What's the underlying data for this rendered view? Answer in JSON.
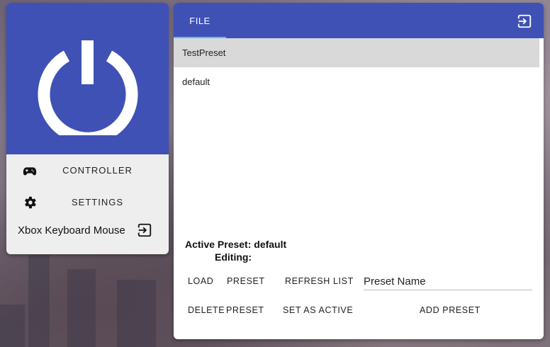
{
  "sidebar": {
    "items": [
      {
        "label": "CONTROLLER",
        "icon": "gamepad-icon"
      },
      {
        "label": "SETTINGS",
        "icon": "gear-icon"
      }
    ],
    "app_name": "Xbox Keyboard Mouse",
    "exit_icon": "exit-icon",
    "hero_icon": "power-icon"
  },
  "header": {
    "tab_file": "FILE",
    "exit_icon": "exit-icon"
  },
  "presets": {
    "items": [
      "TestPreset",
      "default"
    ],
    "selected": "TestPreset"
  },
  "status": {
    "active_preset": "Active Preset: default",
    "editing": "Editing:"
  },
  "actions": {
    "load": "LOAD",
    "preset_1": "PRESET",
    "refresh_list": "REFRESH LIST",
    "delete": "DELETE",
    "preset_2": "PRESET",
    "set_as_active": "SET AS ACTIVE",
    "add_preset": "ADD PRESET"
  },
  "name_field": {
    "placeholder": "Preset Name"
  },
  "colors": {
    "primary": "#3f51b5",
    "tab_indicator": "#4fc3f7",
    "selected_row": "#d9d9d9"
  }
}
